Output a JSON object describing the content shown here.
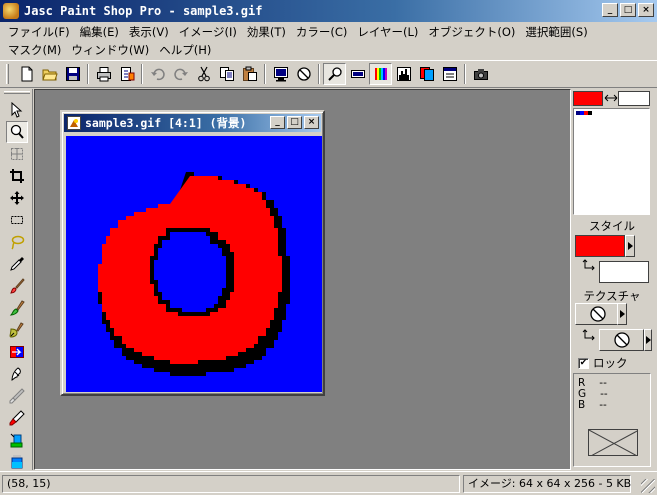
{
  "app": {
    "title": "Jasc Paint Shop Pro - sample3.gif",
    "window_buttons": {
      "minimize": "_",
      "maximize": "□",
      "close": "×"
    }
  },
  "menu": [
    {
      "id": "file",
      "label": "ファイル(F)"
    },
    {
      "id": "edit",
      "label": "編集(E)"
    },
    {
      "id": "view",
      "label": "表示(V)"
    },
    {
      "id": "image",
      "label": "イメージ(I)"
    },
    {
      "id": "effects",
      "label": "効果(T)"
    },
    {
      "id": "colors",
      "label": "カラー(C)"
    },
    {
      "id": "layers",
      "label": "レイヤー(L)"
    },
    {
      "id": "objects",
      "label": "オブジェクト(O)"
    },
    {
      "id": "selections",
      "label": "選択範囲(S)"
    },
    {
      "id": "masks",
      "label": "マスク(M)"
    },
    {
      "id": "window",
      "label": "ウィンドウ(W)"
    },
    {
      "id": "help",
      "label": "ヘルプ(H)"
    }
  ],
  "toolbar": {
    "icons": [
      "new-file-icon",
      "open-folder-icon",
      "save-icon",
      "print-icon",
      "print-preview-icon",
      "undo-icon",
      "redo-icon",
      "cut-icon",
      "copy-icon",
      "paste-icon",
      "full-screen-icon",
      "no-entry-icon",
      "zoom-icon",
      "overview-icon",
      "color-palette-icon",
      "histogram-icon",
      "layer-palette-icon",
      "tool-options-icon",
      "camera-icon"
    ]
  },
  "tools": [
    "arrow-icon",
    "zoom-tool-icon",
    "deform-icon",
    "crop-icon",
    "move-icon",
    "rect-select-icon",
    "lasso-icon",
    "dropper-icon",
    "paintbrush-icon",
    "clone-brush-icon",
    "color-replacer-icon",
    "retouch-icon",
    "scratch-remover-icon",
    "eraser-icon",
    "picture-tube-icon",
    "airbrush-icon",
    "flood-fill-icon"
  ],
  "document": {
    "title": "sample3.gif [4:1] (背景)",
    "image": {
      "background_color": "#0000ff",
      "ring_color": "#ff0000",
      "outline_color": "#000000"
    }
  },
  "color_panel": {
    "foreground_color": "#ff0000",
    "background_color": "#ffffff",
    "style_label": "スタイル",
    "texture_label": "テクスチャ",
    "lock_label": "ロック",
    "lock_checked": true,
    "rgb": [
      {
        "channel": "R",
        "value": "--"
      },
      {
        "channel": "G",
        "value": "--"
      },
      {
        "channel": "B",
        "value": "--"
      }
    ]
  },
  "status": {
    "coords": "(58, 15)",
    "image_info": "イメージ:  64 x 64 x 256 - 5 KB"
  }
}
